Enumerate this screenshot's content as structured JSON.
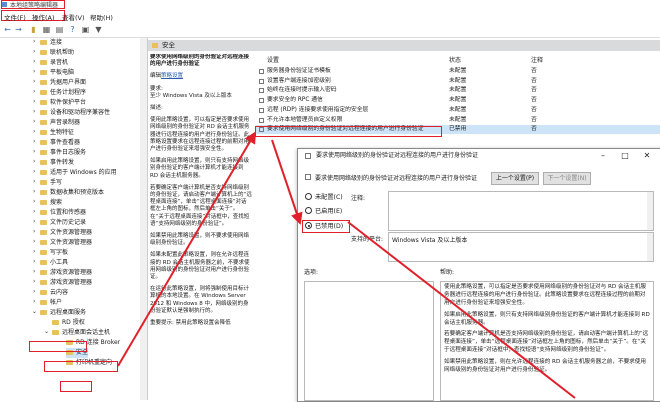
{
  "window": {
    "title": "本地组策略编辑器"
  },
  "menu": [
    {
      "label": "文件(F)"
    },
    {
      "label": "操作(A)"
    },
    {
      "label": "查看(V)"
    },
    {
      "label": "帮助(H)"
    }
  ],
  "tree": {
    "items": [
      {
        "label": "连接",
        "level": 1
      },
      {
        "label": "联机帮助",
        "level": 1
      },
      {
        "label": "录音机",
        "level": 1
      },
      {
        "label": "平板电脑",
        "level": 1
      },
      {
        "label": "凭据用户界面",
        "level": 1
      },
      {
        "label": "任务计划程序",
        "level": 1
      },
      {
        "label": "软件保护平台",
        "level": 1
      },
      {
        "label": "设备和驱动程序兼容性",
        "level": 1
      },
      {
        "label": "声音录制器",
        "level": 1
      },
      {
        "label": "生物特征",
        "level": 1
      },
      {
        "label": "事件查看器",
        "level": 1
      },
      {
        "label": "事件日志服务",
        "level": 1
      },
      {
        "label": "事件转发",
        "level": 1
      },
      {
        "label": "适用于 Windows 的应用",
        "level": 1
      },
      {
        "label": "手写",
        "level": 1
      },
      {
        "label": "数据收集和预览版本",
        "level": 1
      },
      {
        "label": "搜索",
        "level": 1
      },
      {
        "label": "位置和传感器",
        "level": 1
      },
      {
        "label": "文件历史记录",
        "level": 1
      },
      {
        "label": "文件资源管理器",
        "level": 1
      },
      {
        "label": "文件资源管理器",
        "level": 1
      },
      {
        "label": "写字板",
        "level": 1
      },
      {
        "label": "小工具",
        "level": 1
      },
      {
        "label": "游戏资源管理器",
        "level": 1
      },
      {
        "label": "游戏资源管理器",
        "level": 1
      },
      {
        "label": "云内容",
        "level": 1
      },
      {
        "label": "帐户",
        "level": 1
      },
      {
        "label": "远程桌面服务",
        "level": 1
      },
      {
        "label": "RD 授权",
        "level": 2
      },
      {
        "label": "远程桌面会话主机",
        "level": 2
      },
      {
        "label": "RD 连接 Broker",
        "level": 3
      },
      {
        "label": "安全",
        "level": 3
      },
      {
        "label": "打印机重定向",
        "level": 3
      }
    ]
  },
  "panel": {
    "header": "安全",
    "desc_title": "要求使用网络级别的身份验证对远程连接的用户进行身份验证",
    "edit_label": "编辑",
    "edit_link": "策略设置",
    "req_label": "要求:",
    "req_value": "至少 Windows Vista 及以上版本",
    "desc_label": "描述:",
    "desc_paras": [
      "使用此策略设置，可以指定是否要求使用网络级别的身份验证对 RD 会话主机服务器进行远程连接的用户进行身份验证。此策略设置要求在远程连接过程的前期对用户进行身份验证来增强安全性。",
      "如果启用此策略设置，则只有支持网络级别身份验证的客户端计算机才能连接到 RD 会话主机服务器。",
      "若要确定客户端计算机是否支持网络级别的身份验证，请启动客户端计算机上的“远程桌面连接”，单击“远程桌面连接”对话框左上角的图标，然后单击“关于”。在“关于远程桌面连接”对话框中，查找短语“支持网络级别的身份验证”。",
      "如果禁用此策略设置，则不要求使用网络级别身份验证。",
      "如果未配置此策略设置，则在允许远程连接的 RD 会话主机服务器之前，不要求使用网络级别的身份验证对用户进行身份验证。",
      "在运行此策略设置，则将强制使用目标计算机的本地设置。在 Windows Server 2012 和 Windows 8 中，网络级别的身份验证默认是强制执行的。",
      "重要提示: 禁用此策略设置会降低"
    ]
  },
  "list": {
    "columns": {
      "setting": "设置",
      "state": "状态",
      "comment": "注释"
    },
    "rows": [
      {
        "name": "服务器身份验证证书模板",
        "state": "未配置",
        "comment": "否"
      },
      {
        "name": "设置客户端连接加密级别",
        "state": "未配置",
        "comment": "否"
      },
      {
        "name": "始终在连接时提示输入密码",
        "state": "未配置",
        "comment": "否"
      },
      {
        "name": "要求安全的 RPC 通信",
        "state": "未配置",
        "comment": "否"
      },
      {
        "name": "远程 (RDP) 连接要求使用指定的安全层",
        "state": "未配置",
        "comment": "否"
      },
      {
        "name": "不允许本地管理员自定义权限",
        "state": "未配置",
        "comment": "否"
      },
      {
        "name": "要求使用网络级别的身份验证对远程连接的用户进行身份验证",
        "state": "已禁用",
        "comment": "否"
      }
    ]
  },
  "dialog": {
    "title": "要求使用网络级别的身份验证对远程连接的用户进行身份验证",
    "subtitle": "要求使用网络级别的身份验证对远程连接的用户进行身份验证",
    "prev_btn": "上一个设置(P)",
    "next_btn": "下一个设置(N)",
    "radio_not_configured": "未配置(C)",
    "radio_enabled": "已启用(E)",
    "radio_disabled": "已禁用(D)",
    "selected": "disabled",
    "comment_label": "注释:",
    "supported_label": "支持的平台:",
    "supported_value": "Windows Vista 及以上版本",
    "options_label": "选项:",
    "help_label": "帮助:",
    "help_paras": [
      "使用此策略设置，可以指定是否要求使用网络级别的身份验证对与 RD 会话主机服务器进行远程连接的用户进行身份验证。此策略设置要求在远程连接过程的前期对用户进行身份验证来增强安全性。",
      "如果启用此策略设置，则只有支持网络级别身份验证的客户端计算机才能连接到 RD 会话主机服务器。",
      "若要确定客户端计算机是否支持网络级别的身份验证，请启动客户端计算机上的“远程桌面连接”，单击“远程桌面连接”对话框左上角的图标，然后单击“关于”。在“关于远程桌面连接”对话框中，查找短语“支持网络级别的身份验证”。",
      "如果禁用此策略设置，则在允许远程连接的 RD 会话主机服务器之前，不要求使用网络级别的身份验证对用户进行身份验证。"
    ]
  }
}
